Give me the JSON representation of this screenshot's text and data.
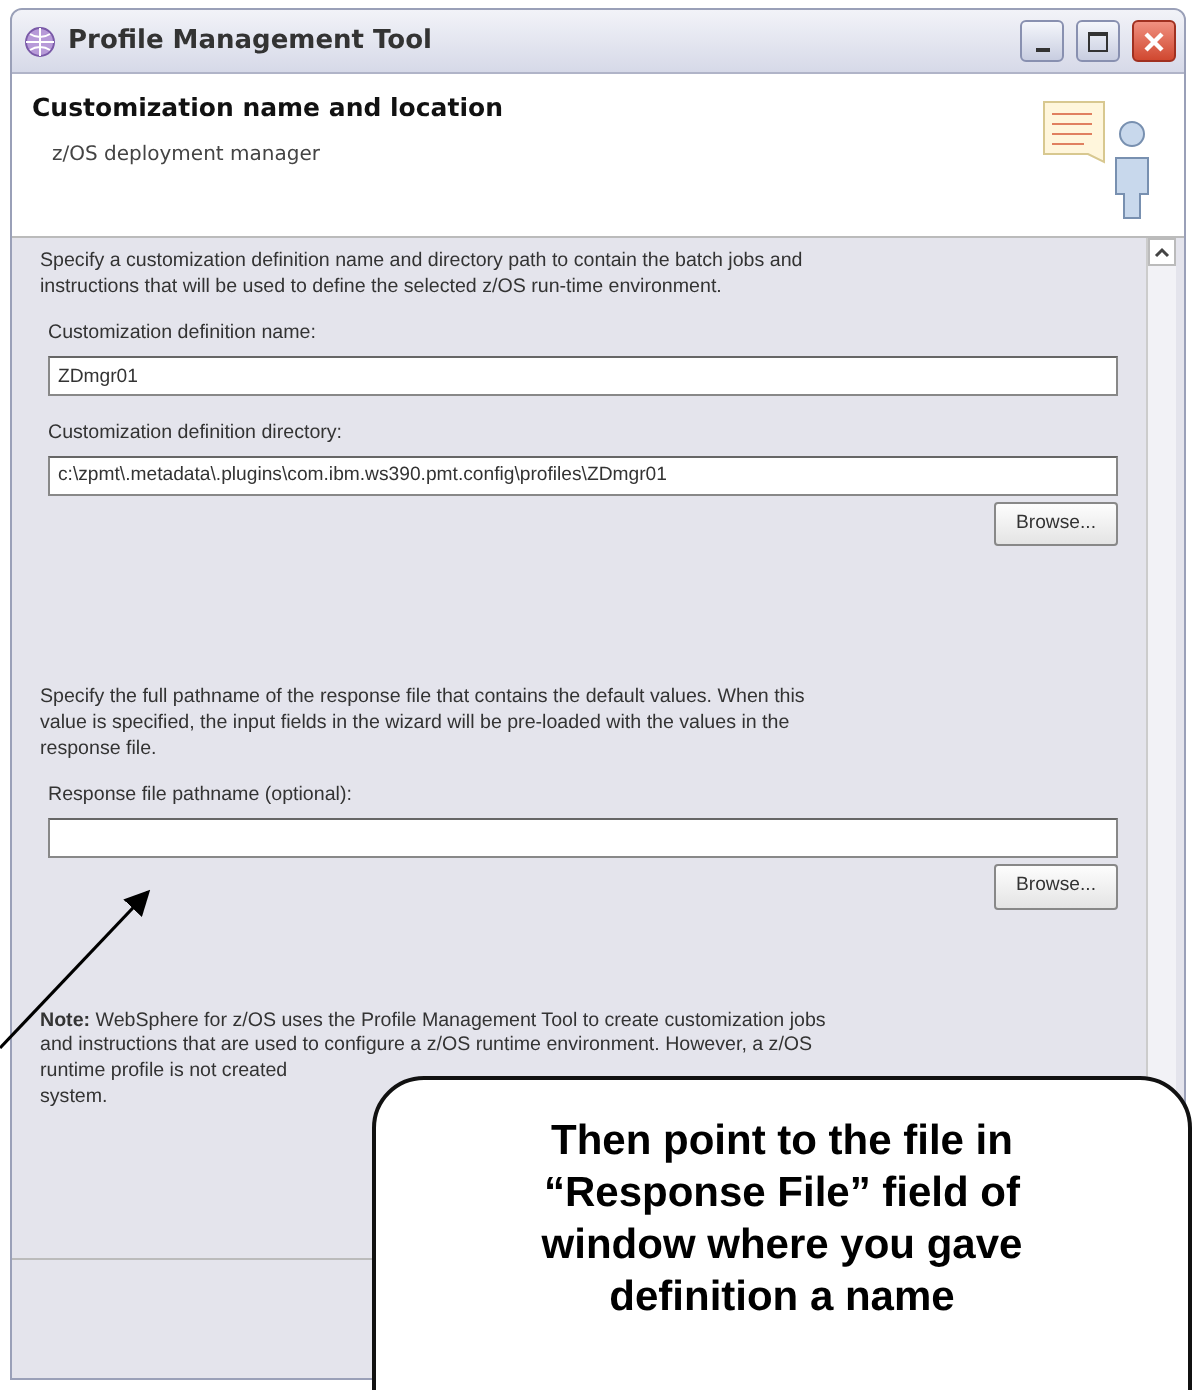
{
  "window": {
    "title": "Profile Management Tool"
  },
  "header": {
    "title": "Customization name and location",
    "subtitle": "z/OS deployment manager"
  },
  "content": [
    {
      "kind": "text",
      "text": "Specify a customization definition name and directory path to contain the batch jobs and\ninstructions that will be used to define the selected z/OS run-time environment."
    },
    {
      "kind": "field",
      "label": "Customization definition name:",
      "value": "ZDmgr01"
    },
    {
      "kind": "field",
      "label": "Customization definition directory:",
      "value": "c:\\zpmt\\.metadata\\.plugins\\com.ibm.ws390.pmt.config\\profiles\\ZDmgr01"
    },
    {
      "kind": "button",
      "label": "Browse..."
    },
    {
      "kind": "text",
      "text": "Specify the full pathname of the response file that contains the default values. When this\nvalue is specified, the input fields in the wizard will be pre-loaded with the values in the\nresponse file."
    },
    {
      "kind": "field",
      "label": "Response file pathname (optional):"
    },
    {
      "kind": "button",
      "label": "Browse..."
    },
    {
      "kind": "text",
      "text": "**Note:** WebSphere for z/OS uses the Profile Management Tool to create customization jobs\nand instructions that are used to configure a z/OS runtime environment. However, a z/OS\nruntime profile is not created\nsystem."
    }
  ],
  "callout": {
    "lines": [
      "Then point to the file in",
      "“Response File” field of",
      "window where you gave",
      "definition a name"
    ]
  }
}
